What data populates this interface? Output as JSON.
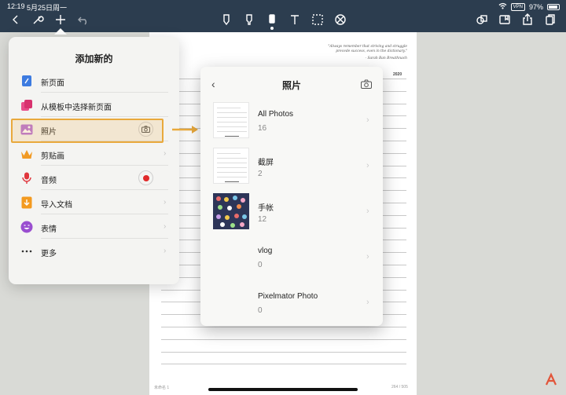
{
  "status_bar": {
    "time": "12:19",
    "date": "5月25日周一",
    "vpn": "VPN",
    "battery": "97%"
  },
  "toolbar": {
    "left_icons": [
      "back-icon",
      "wrench-icon",
      "plus-icon",
      "undo-icon"
    ],
    "center_tools": [
      "pen-icon",
      "highlighter-icon",
      "eraser-icon",
      "text-icon",
      "lasso-icon",
      "no-touch-icon"
    ],
    "right_icons": [
      "shapes-icon",
      "bookmark-icon",
      "share-icon",
      "pages-icon"
    ]
  },
  "page": {
    "quote": "\"Always remember that striving and struggle precede success, even in the dictionary.\"",
    "quote_author": "- Sarah Ban Breathnach",
    "year": "2020",
    "footer_left": "未命名 1",
    "footer_right": "264 / 505"
  },
  "add_menu": {
    "title": "添加新的",
    "items": [
      {
        "label": "新页面",
        "icon": "new-page-icon"
      },
      {
        "label": "从模板中选择新页面",
        "icon": "template-icon"
      },
      {
        "label": "照片",
        "icon": "photo-icon",
        "highlighted": true
      },
      {
        "label": "剪贴画",
        "icon": "crown-icon"
      },
      {
        "label": "音频",
        "icon": "microphone-icon"
      },
      {
        "label": "导入文档",
        "icon": "import-document-icon"
      },
      {
        "label": "表情",
        "icon": "emoji-icon"
      },
      {
        "label": "更多",
        "icon": "more-icon"
      }
    ]
  },
  "photos_panel": {
    "title": "照片",
    "albums": [
      {
        "name": "All Photos",
        "count": "16"
      },
      {
        "name": "截屏",
        "count": "2"
      },
      {
        "name": "手帐",
        "count": "12"
      },
      {
        "name": "vlog",
        "count": "0"
      },
      {
        "name": "Pixelmator Photo",
        "count": "0"
      }
    ]
  },
  "colors": {
    "toolbar_bg": "#2c3d4f",
    "highlight": "#e9a93c"
  }
}
